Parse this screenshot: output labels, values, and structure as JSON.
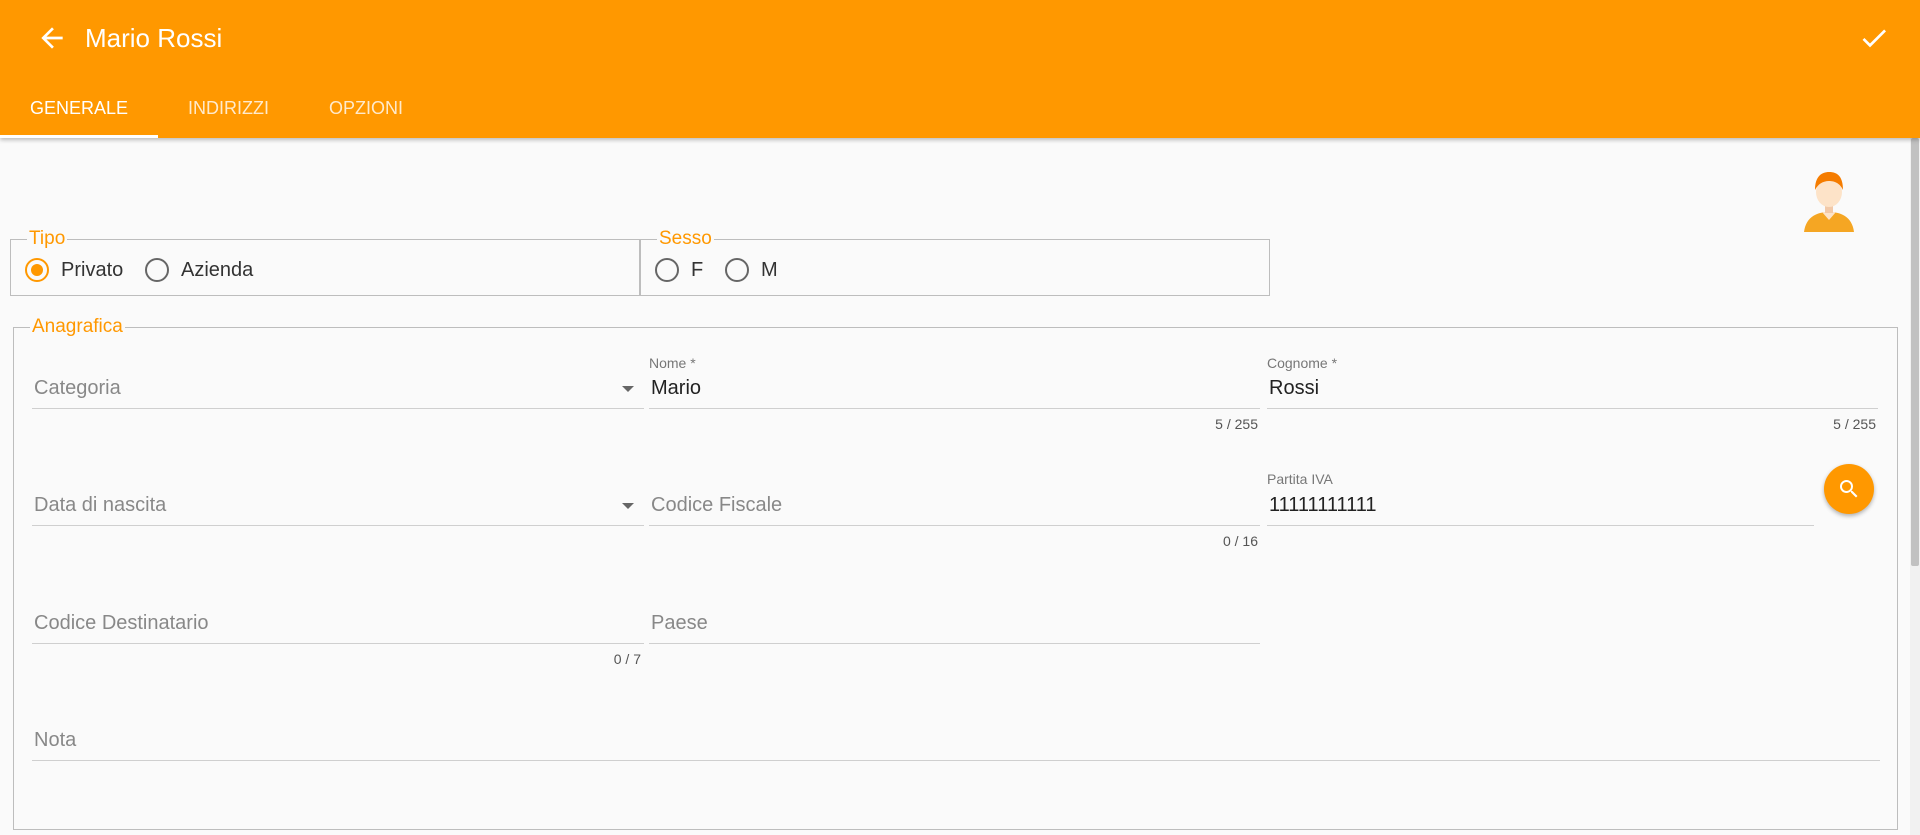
{
  "header": {
    "title": "Mario Rossi",
    "back_icon": "arrow-left-icon",
    "confirm_icon": "check-icon",
    "color": "#ff9800"
  },
  "tabs": [
    {
      "label": "GENERALE",
      "active": true
    },
    {
      "label": "INDIRIZZI",
      "active": false
    },
    {
      "label": "OPZIONI",
      "active": false
    }
  ],
  "tipo": {
    "legend": "Tipo",
    "options": [
      {
        "label": "Privato",
        "selected": true
      },
      {
        "label": "Azienda",
        "selected": false
      }
    ]
  },
  "sesso": {
    "legend": "Sesso",
    "options": [
      {
        "label": "F",
        "selected": false
      },
      {
        "label": "M",
        "selected": false
      }
    ]
  },
  "anagrafica": {
    "legend": "Anagrafica",
    "categoria": {
      "placeholder": "Categoria"
    },
    "nome": {
      "label": "Nome *",
      "value": "Mario",
      "counter": "5 / 255"
    },
    "cognome": {
      "label": "Cognome *",
      "value": "Rossi",
      "counter": "5 / 255"
    },
    "data_nascita": {
      "placeholder": "Data di nascita"
    },
    "codice_fiscale": {
      "placeholder": "Codice Fiscale",
      "counter": "0 / 16"
    },
    "partita_iva": {
      "label": "Partita IVA",
      "value": "11111111111"
    },
    "codice_destinatario": {
      "placeholder": "Codice Destinatario",
      "counter": "0 / 7"
    },
    "paese": {
      "placeholder": "Paese"
    },
    "nota": {
      "placeholder": "Nota"
    }
  },
  "search_button_icon": "search-icon",
  "avatar_icon": "user-avatar-icon"
}
